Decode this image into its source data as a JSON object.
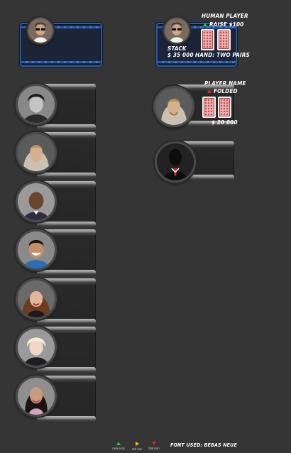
{
  "human_player": {
    "title": "HUMAN PLAYER",
    "action": "RAISE $100",
    "stack_label": "STACK",
    "stack_value": "$ 35 000",
    "hand": "HAND: TWO PAIRS",
    "action_color": "#27c93f"
  },
  "folded_player": {
    "title": "PLAYER NAME",
    "status": "FOLDED",
    "stack_value": "$ 20 000",
    "status_color": "#e0262b"
  },
  "legend": {
    "raise_label": "raise icon",
    "call_label": "call icon",
    "fold_label": "fold icon"
  },
  "footer": {
    "font_note": "FONT USED: BEBAS NEUE"
  },
  "colors": {
    "background": "#353535",
    "blue_plate": "#1b2537",
    "blue_border": "#2f5fa8"
  },
  "avatars": [
    "man-with-sunglasses-icon",
    "dark-haired-man-bw-icon",
    "hooded-man-icon",
    "bald-man-icon",
    "smiling-man-icon",
    "curly-haired-woman-icon",
    "blonde-woman-icon",
    "dark-haired-woman-icon",
    "anonymous-silhouette-icon"
  ]
}
